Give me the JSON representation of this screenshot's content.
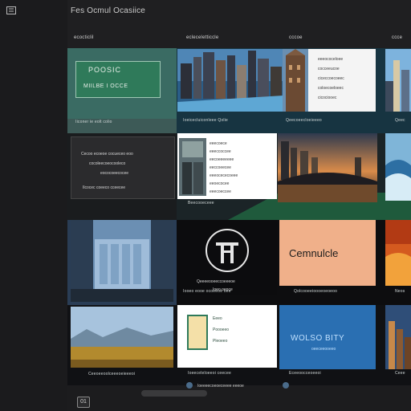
{
  "app": {
    "title": "Fes Ocmul Ocasiice"
  },
  "columns": [
    "ecocticlil",
    "ecleceletticcle",
    "cccoe",
    "ccce"
  ],
  "tiles": {
    "r1c1": {
      "heading": "POOSIC",
      "sub": "MIILBE I OCCE",
      "caption": "Iiconer ie eolt colio"
    },
    "r1c2": {
      "caption": "Ioeicecluiconleee Qolie"
    },
    "r1c3": {
      "lines": [
        "eeeococeloee",
        "cocceeucoe",
        "ciceccoecoeec",
        "coloecoeloeec",
        "cicociooec"
      ],
      "caption": "Qeecoeecloeieeeo"
    },
    "r1c4": {
      "caption": "Qeec"
    },
    "r2c1": {
      "lines": [
        "Cecoo ecoeoe cocueceo eoo",
        "cocoleecoeocooleco",
        "eococoeecocee",
        "Ilcocec coeeco cceecee"
      ]
    },
    "r2c2": {
      "lines": [
        "eeecoece",
        "eeeccoccee",
        "eecoeeeeeee",
        "eeccoeecee",
        "eeeocececoeee",
        "eeoecocee",
        "eeecoeccee"
      ],
      "caption": "Beecooeceee"
    },
    "r3c2": {
      "caption": "Qeeeeooeeccoeeeoe",
      "sub": "Ioeo oeoce",
      "foot": "Iooeo eooe ocoeeoe oee"
    },
    "r3c3": {
      "heading": "Cemnulcle",
      "caption": "Qolcooeeioooeoeoeoo"
    },
    "r3c4": {
      "caption": "Neos"
    },
    "r4c1": {
      "caption": "Ceeoeeoolceeeoeieeeoi"
    },
    "r4c2": {
      "lines": [
        "Eeeo",
        "Poooeeo",
        "Pleoeeo"
      ],
      "caption": "Ioeeceleloeeoi ceecee"
    },
    "r4c3": {
      "heading": "WOLSO BITY",
      "sub": "oeeceeooeeo",
      "caption": "Eceeoocceoeeoi"
    },
    "r4c4": {
      "caption": "Ceee"
    }
  },
  "footer": {
    "page": "01",
    "status": "Ioeeeecoeoeceeee eeeoe"
  },
  "colors": {
    "accent": "#2f6b4e",
    "blue": "#2a6fb2",
    "orange": "#f0b08a"
  }
}
